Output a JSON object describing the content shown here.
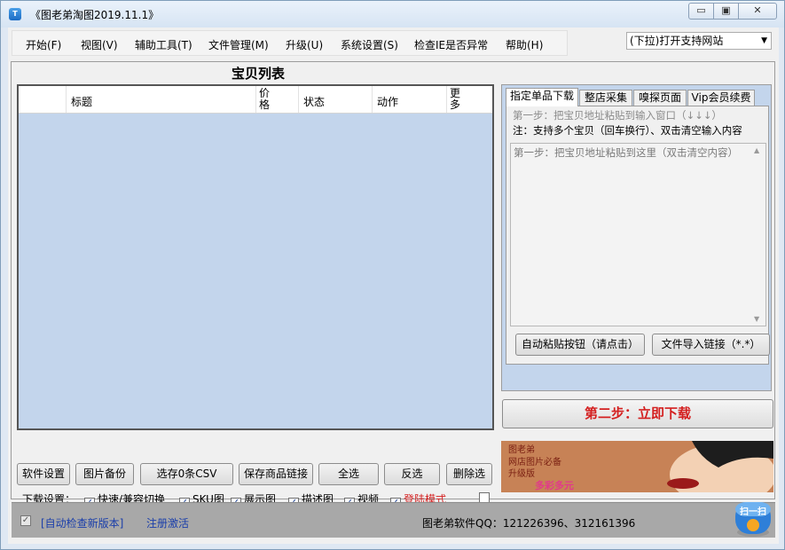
{
  "window": {
    "title": "《图老弟淘图2019.11.1》",
    "icon_text": "T"
  },
  "controls": {
    "minimize": "▭",
    "maximize": "▣",
    "close": "✕"
  },
  "menu": [
    "开始(F)",
    "视图(V)",
    "辅助工具(T)",
    "文件管理(M)",
    "升级(U)",
    "系统设置(S)",
    "检查IE是否异常",
    "帮助(H)"
  ],
  "site_select": {
    "value": "(下拉)打开支持网站",
    "arrow": "▼"
  },
  "list": {
    "title": "宝贝列表",
    "columns": [
      "",
      "标题",
      "价格",
      "状态",
      "动作",
      "更多"
    ]
  },
  "tabs": [
    "指定单品下载",
    "整店采集",
    "嗅探页面",
    "Vip会员续费"
  ],
  "tab_content": {
    "step_hint": "第一步：把宝贝地址粘贴到输入窗口（↓↓↓）",
    "note": "注：支持多个宝贝（回车换行）、双击清空输入内容",
    "textarea_placeholder": "第一步：把宝贝地址粘贴到这里（双击清空内容）",
    "auto_paste_button": "自动粘贴按钮（请点击）",
    "import_button": "文件导入链接（*.*）",
    "scroll_up": "▲",
    "scroll_down": "▼"
  },
  "download_button": "第二步：立即下载",
  "ad": {
    "line1": "图老弟",
    "line2": "网店图片必备",
    "line3": "升级版",
    "line4": "多彩多元"
  },
  "toolbar_buttons": [
    "软件设置",
    "图片备份",
    "选存0条CSV",
    "保存商品链接",
    "全选",
    "反选",
    "删除选"
  ],
  "download_settings": {
    "label": "下载设置：",
    "options": [
      {
        "label": "快速/兼容切换",
        "checked": true
      },
      {
        "label": "SKU图",
        "checked": true
      },
      {
        "label": "展示图",
        "checked": true
      },
      {
        "label": "描述图",
        "checked": true
      },
      {
        "label": "视频",
        "checked": true
      },
      {
        "label": "登陆模式",
        "checked": true,
        "color": "#d42020"
      }
    ]
  },
  "status": {
    "auto_check": "[自动检查新版本]",
    "register": "注册激活",
    "qq": "图老弟软件QQ：121226396、312161396",
    "scan_label": "扫一扫"
  },
  "check_mark": "✓"
}
